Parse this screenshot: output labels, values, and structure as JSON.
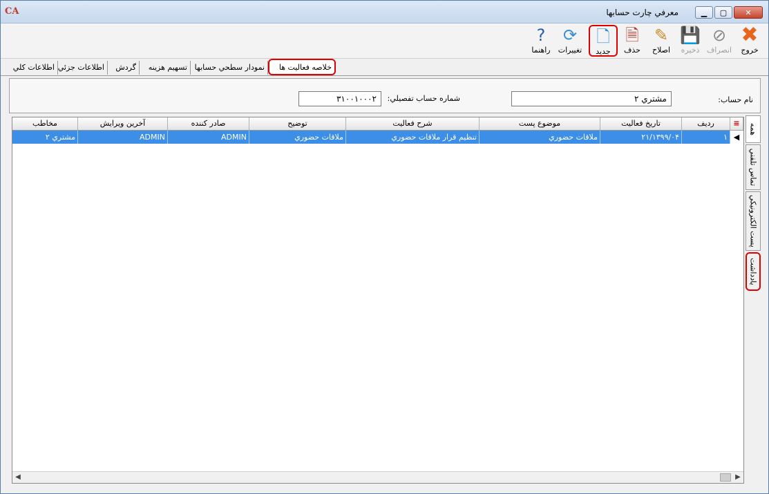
{
  "window": {
    "title": "معرفي چارت حسابها",
    "logo": "CA"
  },
  "toolbar": {
    "exit": "خروج",
    "cancel": "انصراف",
    "save": "ذخيره",
    "edit": "اصلاح",
    "delete": "حذف",
    "new": "جديد",
    "changes": "تغييرات",
    "help": "راهنما"
  },
  "tabs": [
    "خلاصه فعاليت ها",
    "نمودار سطحي حسابها",
    "تسهيم هزينه",
    "گردش",
    "اطلاعات جزئي",
    "اطلاعات كلي"
  ],
  "form": {
    "account_name_label": "نام حساب:",
    "account_name_value": "مشتري ٢",
    "detail_number_label": "شماره حساب تفصيلي:",
    "detail_number_value": "٣١٠٠١٠٠٠٢"
  },
  "grid": {
    "columns": [
      "رديف",
      "تاريخ فعاليت",
      "موضوع پست",
      "شرح فعاليت",
      "توضيح",
      "صادر كننده",
      "آخرين ويرايش",
      "مخاطب"
    ],
    "rows": [
      [
        "١",
        "١٣٩٩/٠۴/٢١",
        "ملاقات حضوري",
        "تنظيم قرار ملاقات حضوري",
        "ملاقات حضوري",
        "ADMIN",
        "ADMIN",
        "مشتري ٢"
      ]
    ]
  },
  "side_tabs": [
    "همه",
    "تماس تلفني",
    "پست الكترونيكي",
    "يادداشت"
  ]
}
